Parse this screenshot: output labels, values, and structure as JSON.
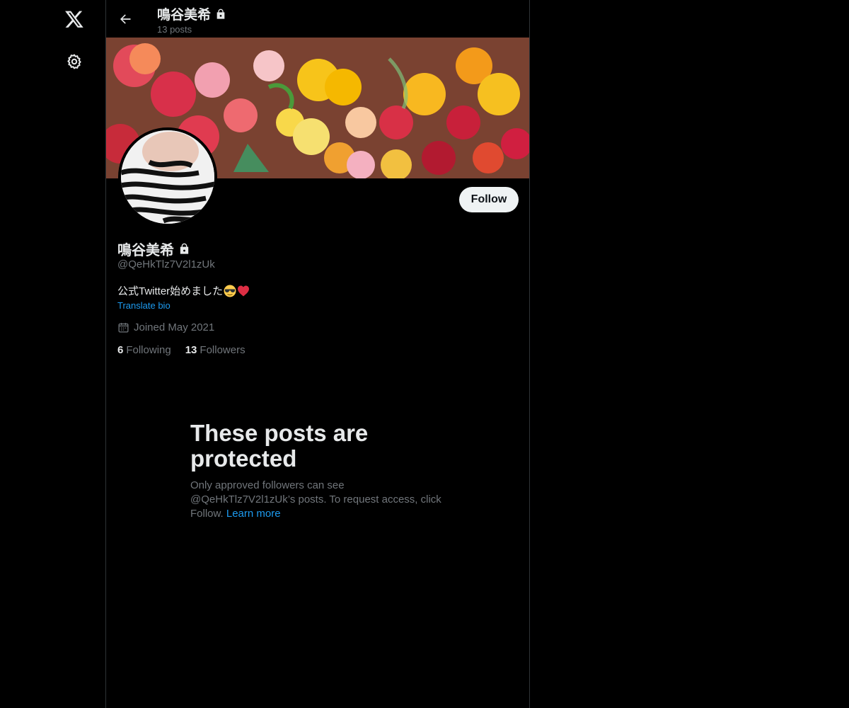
{
  "nav": {
    "logo_icon": "x-logo-icon",
    "settings_icon": "gear-icon"
  },
  "header": {
    "title": "鳴谷美希",
    "subtitle": "13 posts",
    "back_icon": "arrow-left-icon"
  },
  "profile": {
    "display_name": "鳴谷美希",
    "handle": "@QeHkTlz7V2l1zUk",
    "bio_text": "公式Twitter始めました",
    "translate_label": "Translate bio",
    "joined": "Joined May 2021",
    "following_count": "6",
    "following_label": "Following",
    "followers_count": "13",
    "followers_label": "Followers",
    "follow_label": "Follow"
  },
  "protected": {
    "title": "These posts are protected",
    "body": "Only approved followers can see @QeHkTlz7V2l1zUk’s posts. To request access, click Follow.",
    "learn_more": "Learn more"
  },
  "colors": {
    "background": "#000000",
    "accent": "#1d9bf0",
    "text_primary": "#e7e9ea",
    "text_secondary": "#71767b",
    "border": "#2f3336"
  }
}
